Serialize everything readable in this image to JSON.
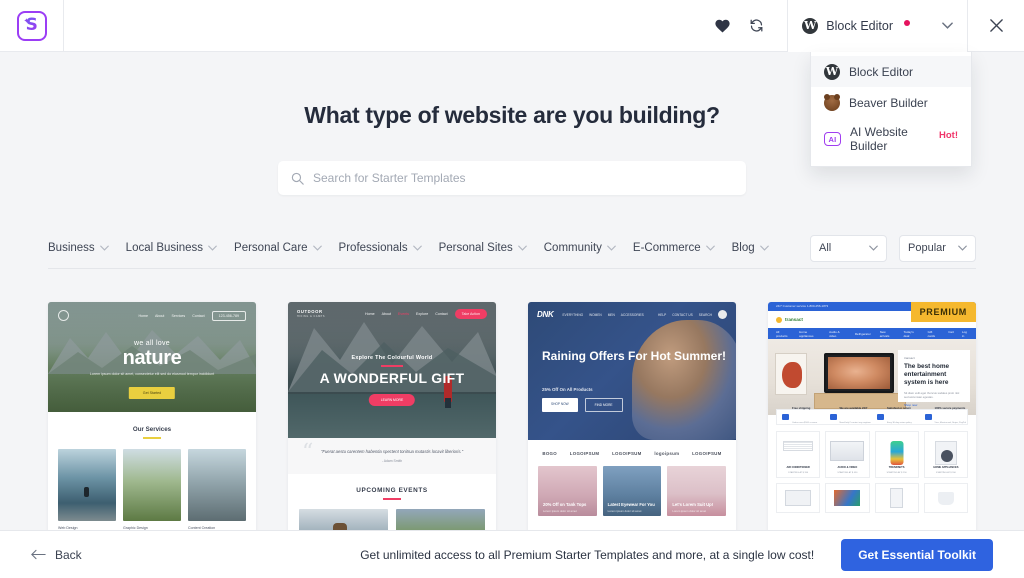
{
  "header": {
    "logo_name": "starter-templates-logo",
    "icons": [
      {
        "name": "favorites-heart-icon"
      },
      {
        "name": "sync-refresh-icon"
      }
    ],
    "editor_switcher": {
      "label": "Block Editor",
      "icon": "wordpress-icon",
      "has_notification_dot": true
    },
    "close_label": "×"
  },
  "dropdown": {
    "items": [
      {
        "label": "Block Editor",
        "icon": "wordpress-icon",
        "badge": "",
        "active": true
      },
      {
        "label": "Beaver Builder",
        "icon": "beaver-icon",
        "badge": "",
        "active": false
      },
      {
        "label": "AI Website Builder",
        "icon": "ai-icon",
        "badge": "Hot!",
        "active": false
      }
    ]
  },
  "main": {
    "title": "What type of website are you building?",
    "search": {
      "placeholder": "Search for Starter Templates",
      "value": "",
      "icon": "search-icon"
    },
    "categories": [
      {
        "label": "Business"
      },
      {
        "label": "Local Business"
      },
      {
        "label": "Personal Care"
      },
      {
        "label": "Professionals"
      },
      {
        "label": "Personal Sites"
      },
      {
        "label": "Community"
      },
      {
        "label": "E-Commerce"
      },
      {
        "label": "Blog"
      }
    ],
    "filters": [
      {
        "name": "type-filter",
        "value": "All"
      },
      {
        "name": "sort-filter",
        "value": "Popular"
      }
    ]
  },
  "templates": [
    {
      "id": "nature",
      "badge": "",
      "nav_links": [
        "Home",
        "About",
        "Services",
        "Contact"
      ],
      "nav_button": "123-456-789",
      "kicker": "we all love",
      "title": "nature",
      "subtitle": "Lorem ipsum dolor sit amet, consectetur elit sed do eiusmod tempor incididunt",
      "cta": "Get Started",
      "section_title": "Our Services",
      "captions": [
        "Web Design",
        "Graphic Design",
        "Content Creation"
      ]
    },
    {
      "id": "outdoor",
      "badge": "",
      "brand": "OUTDOOR",
      "brand_sub": "HIKING & CAMPS",
      "nav_links": [
        "Home",
        "About",
        "Events",
        "Explore",
        "Contact"
      ],
      "nav_button": "Take Action",
      "kicker": "Explore The Colourful World",
      "title": "A WONDERFUL GIFT",
      "cta": "LEARN MORE",
      "quote": "\"Fuerat aestu carentem habentia spectent tonitrua mutastis locavit liberioris.\"",
      "quote_author": "- Adam Smith",
      "section_title": "UPCOMING EVENTS"
    },
    {
      "id": "dnk",
      "badge": "",
      "brand": "DNK",
      "nav_links": [
        "EVERYTHING",
        "WOMEN",
        "MEN",
        "ACCESSORIES"
      ],
      "nav_right": [
        "HELP",
        "CONTACT US",
        "SEARCH"
      ],
      "title": "Raining Offers For Hot Summer!",
      "subtitle": "25% Off On All Products",
      "buttons": [
        "SHOP NOW",
        "FIND MORE"
      ],
      "logos": [
        "BOGO",
        "LOGOIPSUM",
        "LOGOIPSUM",
        "logoipsum",
        "LOGOIPSUM"
      ],
      "products": [
        {
          "title": "20% Off on Tank Tops",
          "sub": "Lorem ipsum dolor sit amet"
        },
        {
          "title": "Latest Eyewear For You",
          "sub": "Lorem ipsum dolor sit amet"
        },
        {
          "title": "Let's Lorem Suit Up!",
          "sub": "Lorem ipsum dolor sit amet"
        }
      ]
    },
    {
      "id": "electronics",
      "badge": "PREMIUM",
      "topbar": "24/7 Customer service 1-800-256-1873",
      "brand": "transact",
      "nav_links": [
        "All products",
        "Home appliances",
        "Audio & video",
        "Refrigerator",
        "New arrivals",
        "Today's deal",
        "Gift cards"
      ],
      "nav_right": [
        "Cart",
        "Log in"
      ],
      "panel_label": "transact",
      "panel_title": "The best home entertainment system is here",
      "panel_text": "Sit diam velit eget rhoncus sodales proin nisl sed accumsan egestas.",
      "panel_link": "Shop now",
      "features": [
        {
          "title": "Free shipping",
          "sub": "Orders over $100 or more"
        },
        {
          "title": "We are available 24/7",
          "sub": "Need help? contact any anytime"
        },
        {
          "title": "Satisfied or return",
          "sub": "Easy 30-day return policy"
        },
        {
          "title": "100% secure payments",
          "sub": "Visa, Mastercard, Stripe, PayPal"
        }
      ],
      "products": [
        {
          "name": "AIR CONDITIONER",
          "price": "STARTING AT $ 350"
        },
        {
          "name": "AUDIO & VIDEO",
          "price": "STARTING AT $ 450"
        },
        {
          "name": "TRENDSETS",
          "price": "STARTING AT $ 250"
        },
        {
          "name": "HOME APPLIANCES",
          "price": "STARTING AT $ 550"
        }
      ]
    }
  ],
  "footer": {
    "back_label": "Back",
    "promo_text": "Get unlimited access to all Premium Starter Templates and more, at a single low cost!",
    "cta_label": "Get Essential Toolkit"
  },
  "colors": {
    "accent_blue": "#2f63e0",
    "badge_gold": "#f5b82e",
    "hot_pink": "#f0356a",
    "notification_red": "#e5135e",
    "logo_purple": "#9b3df5",
    "page_bg": "#f4f5f7"
  }
}
